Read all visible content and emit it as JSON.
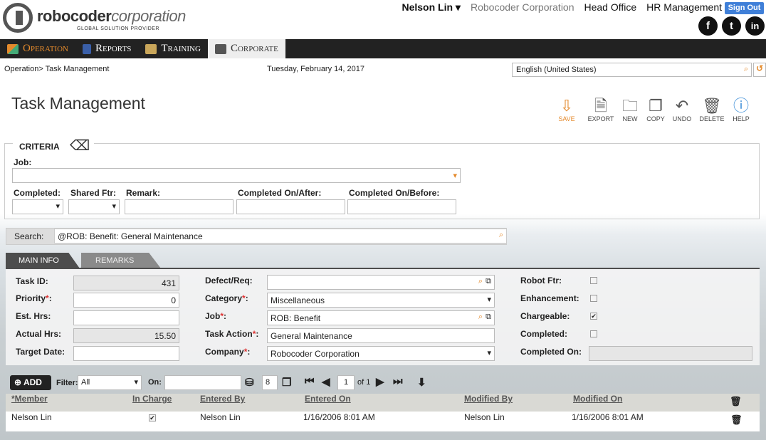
{
  "header": {
    "logo_name_bold": "robocoder",
    "logo_name_italic": "corporation",
    "logo_tagline": "GLOBAL SOLUTION PROVIDER",
    "user": "Nelson Lin",
    "company": "Robocoder Corporation",
    "head_office": "Head Office",
    "hr": "HR Management",
    "sign_out": "Sign Out",
    "social": [
      "f",
      "t",
      "in"
    ]
  },
  "menu": [
    {
      "label": "Operation",
      "icon": "play-icon"
    },
    {
      "label": "Reports",
      "icon": "book-icon"
    },
    {
      "label": "Training",
      "icon": "training-icon"
    },
    {
      "label": "Corporate",
      "icon": "laptop-icon"
    }
  ],
  "breadcrumb": {
    "root": "Operation",
    "current": "Task Management"
  },
  "date": "Tuesday, February 14, 2017",
  "language": "English (United States)",
  "page_title": "Task Management",
  "toolbar": {
    "save": "SAVE",
    "export": "EXPORT",
    "new": "NEW",
    "copy": "COPY",
    "undo": "UNDO",
    "delete": "DELETE",
    "help": "HELP"
  },
  "criteria": {
    "title": "CRITERIA",
    "job_label": "Job:",
    "completed_label": "Completed:",
    "shared_label": "Shared Ftr:",
    "remark_label": "Remark:",
    "on_after_label": "Completed On/After:",
    "on_before_label": "Completed On/Before:"
  },
  "search": {
    "label": "Search:",
    "value": "@ROB: Benefit: General Maintenance"
  },
  "tabs": {
    "main": "MAIN INFO",
    "remarks": "REMARKS"
  },
  "form": {
    "task_id_label": "Task ID:",
    "task_id": "431",
    "priority_label": "Priority",
    "priority": "0",
    "est_label": "Est. Hrs:",
    "est": "",
    "actual_label": "Actual Hrs:",
    "actual": "15.50",
    "target_label": "Target Date:",
    "target": "",
    "defect_label": "Defect/Req:",
    "defect": "",
    "category_label": "Category",
    "category": "Miscellaneous",
    "job_label": "Job",
    "job": "ROB: Benefit",
    "action_label": "Task Action",
    "action": "General Maintenance",
    "company_label": "Company",
    "company": "Robocoder Corporation",
    "robot_label": "Robot Ftr:",
    "enh_label": "Enhancement:",
    "charge_label": "Chargeable:",
    "completed_label": "Completed:",
    "completed_on_label": "Completed On:"
  },
  "checks": {
    "robot": false,
    "enh": false,
    "charge": true,
    "completed": false
  },
  "grid": {
    "add": "ADD",
    "filter_label": "Filter:",
    "filter": "All",
    "on_label": "On:",
    "count": "8",
    "page": "1",
    "of": "of 1",
    "columns": [
      "*Member",
      "In Charge",
      "Entered By",
      "Entered On",
      "Modified By",
      "Modified On"
    ],
    "row": {
      "member": "Nelson Lin",
      "in_charge": true,
      "entered_by": "Nelson Lin",
      "entered_on": "1/16/2006 8:01 AM",
      "modified_by": "Nelson Lin",
      "modified_on": "1/16/2006 8:01 AM"
    }
  },
  "colors": {
    "accent": "#e48a2c",
    "menu_bg": "#222222",
    "signout": "#3f7fd8"
  }
}
